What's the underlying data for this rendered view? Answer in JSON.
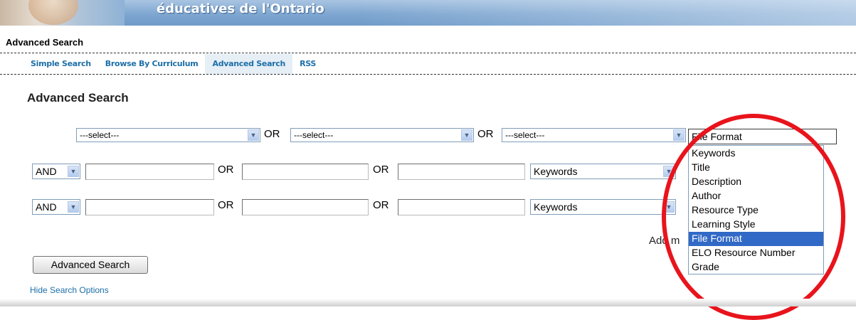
{
  "banner": {
    "title": "éducatives de l'Ontario"
  },
  "page_heading": "Advanced Search",
  "tabs": [
    {
      "label": "Simple Search"
    },
    {
      "label": "Browse By Curriculum"
    },
    {
      "label": "Advanced Search"
    },
    {
      "label": "RSS"
    }
  ],
  "section_title": "Advanced Search",
  "row1": {
    "select1": "---select---",
    "or1": "OR",
    "select2": "---select---",
    "or2": "OR",
    "select3": "---select---",
    "field_select": "File Format"
  },
  "row2": {
    "operator": "AND",
    "input1": "",
    "or1": "OR",
    "input2": "",
    "or2": "OR",
    "input3": "",
    "field_select": "Keywords"
  },
  "row3": {
    "operator": "AND",
    "input1": "",
    "or1": "OR",
    "input2": "",
    "or2": "OR",
    "input3": "",
    "field_select": "Keywords"
  },
  "add_more_text": "Add m",
  "dropdown_options": [
    "Keywords",
    "Title",
    "Description",
    "Author",
    "Resource Type",
    "Learning Style",
    "File Format",
    "ELO Resource Number",
    "Grade"
  ],
  "dropdown_selected": "File Format",
  "search_button": "Advanced Search",
  "hide_options_link": "Hide Search Options",
  "colors": {
    "link": "#1d6fa8",
    "selection": "#3169c6",
    "annotation": "#e8141c"
  }
}
